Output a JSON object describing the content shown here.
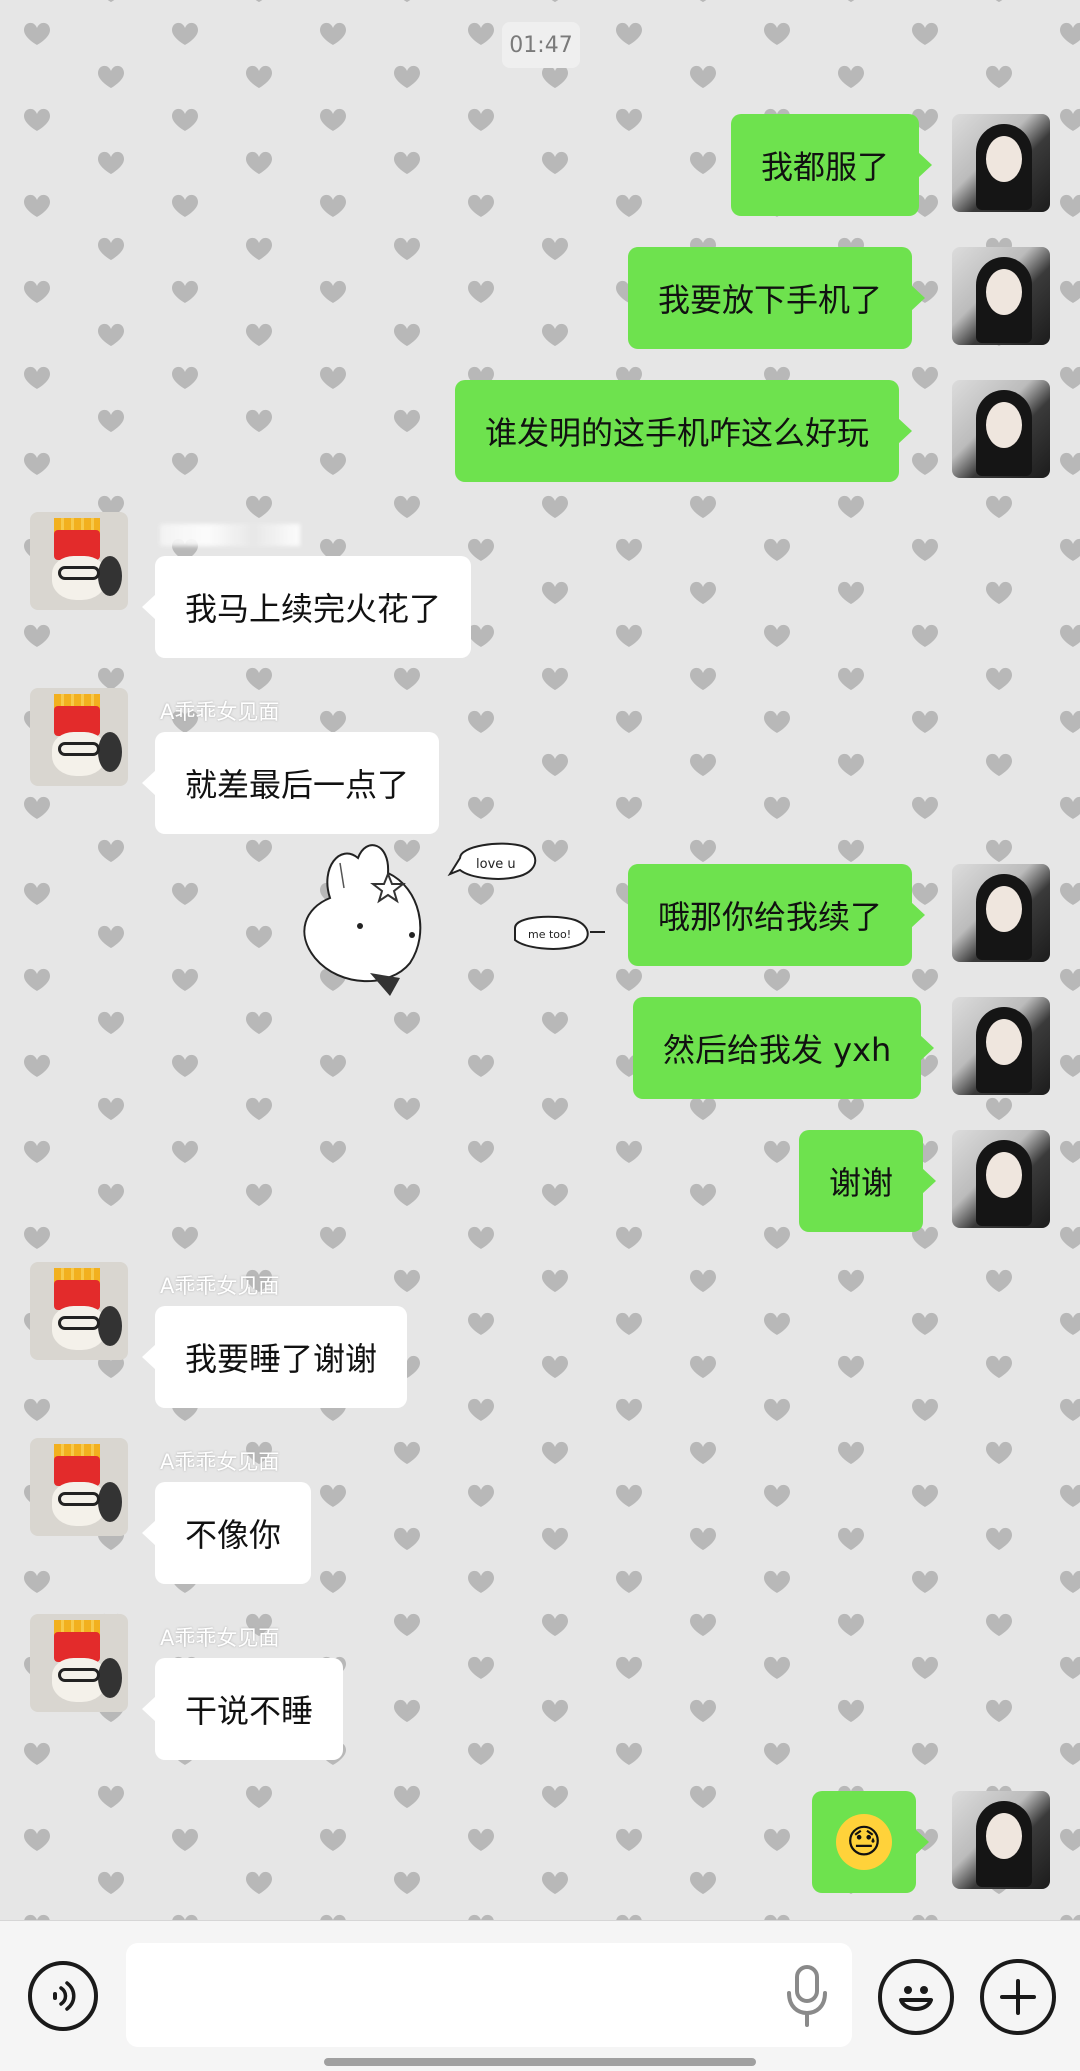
{
  "chat": {
    "timestamp": "01:47",
    "sender_name": "A乖乖女见面"
  },
  "messages": [
    {
      "from": "me",
      "text": "我都服了"
    },
    {
      "from": "me",
      "text": "我要放下手机了"
    },
    {
      "from": "me",
      "text": "谁发明的这手机咋这么好玩"
    },
    {
      "from": "other",
      "text": "我马上续完火花了"
    },
    {
      "from": "other",
      "text": "就差最后一点了"
    },
    {
      "from": "other",
      "sticker": true,
      "sticker_text": [
        "love u",
        "me too!"
      ]
    },
    {
      "from": "me",
      "text": "哦那你给我续了"
    },
    {
      "from": "me",
      "text": "然后给我发 yxh"
    },
    {
      "from": "me",
      "text": "谢谢"
    },
    {
      "from": "other",
      "text": "我要睡了谢谢"
    },
    {
      "from": "other",
      "text": "不像你"
    },
    {
      "from": "other",
      "text": "干说不睡"
    },
    {
      "from": "me",
      "emoji": "😓"
    }
  ],
  "composer": {
    "placeholder": "",
    "icons": [
      "voice-icon",
      "microphone-icon",
      "emoji-icon",
      "plus-icon"
    ]
  }
}
